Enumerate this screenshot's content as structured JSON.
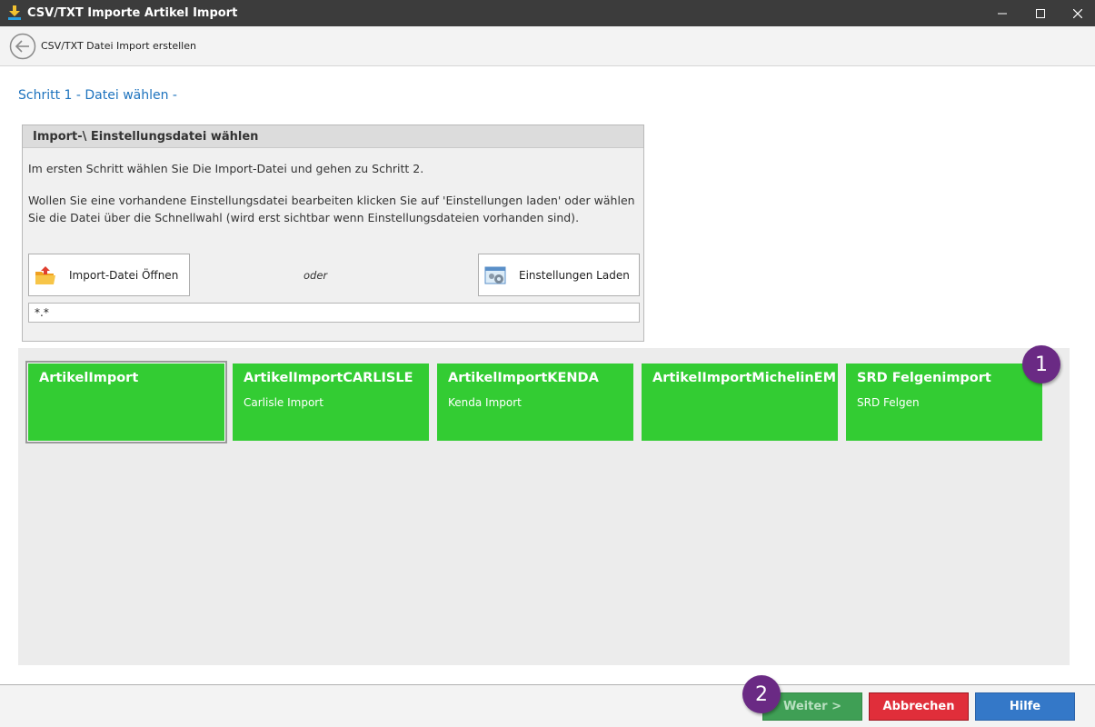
{
  "window": {
    "title": "CSV/TXT Importe Artikel Import",
    "icon": "download-arrow-icon",
    "controls": [
      "minimize",
      "maximize",
      "close"
    ]
  },
  "nav": {
    "back_icon": "back-arrow-icon",
    "title": "CSV/TXT Datei Import erstellen"
  },
  "step": {
    "title": "Schritt 1 - Datei wählen -"
  },
  "panel": {
    "header": "Import-\\ Einstellungsdatei wählen",
    "text1": "Im ersten Schritt wählen Sie Die Import-Datei und gehen zu Schritt 2.",
    "text2": "Wollen Sie eine vorhandene Einstellungsdatei bearbeiten klicken Sie auf 'Einstellungen laden' oder wählen Sie die Datei über die Schnellwahl (wird erst sichtbar wenn Einstellungsdateien vorhanden sind).",
    "open_button": "Import-Datei Öffnen",
    "or_label": "oder",
    "load_button": "Einstellungen Laden",
    "file_pattern": "*.*"
  },
  "tiles": [
    {
      "name": "ArtikelImport",
      "description": "",
      "selected": true
    },
    {
      "name": "ArtikelImportCARLISLE",
      "description": "Carlisle Import",
      "selected": false
    },
    {
      "name": "ArtikelImportKENDA",
      "description": "Kenda Import",
      "selected": false
    },
    {
      "name": "ArtikelImportMichelinEM",
      "description": "",
      "selected": false
    },
    {
      "name": "SRD Felgenimport",
      "description": "SRD Felgen",
      "selected": false
    }
  ],
  "badges": {
    "one": "1",
    "two": "2"
  },
  "footer": {
    "next_button": "Weiter >",
    "cancel_button": "Abbrechen",
    "help_button": "Hilfe"
  },
  "colors": {
    "tile_green": "#33cc33",
    "badge_purple": "#6a2a84",
    "next_green": "#3f9f55",
    "cancel_red": "#e02e3a",
    "help_blue": "#3478c8",
    "step_title_blue": "#1e73be"
  }
}
